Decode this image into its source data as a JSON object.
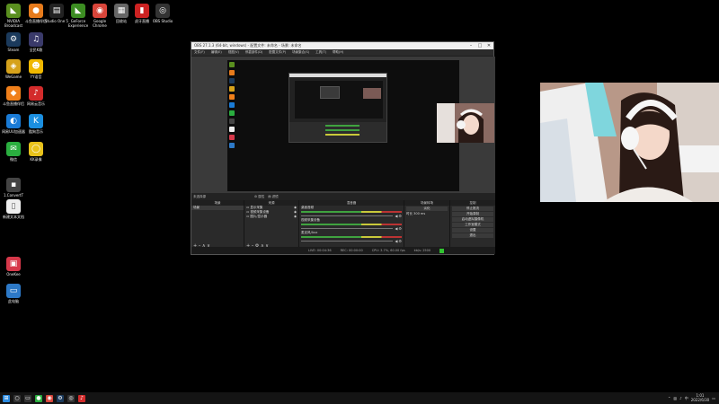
{
  "desktop_icons": [
    {
      "label": "NVIDIA Broadcast",
      "color": "#5a8f1f",
      "glyph": "◣"
    },
    {
      "label": "斗鱼直播伴侣",
      "color": "#e67b1c",
      "glyph": "●"
    },
    {
      "label": "Studio One 5",
      "color": "#222222",
      "glyph": "▤"
    },
    {
      "label": "GeForce Experience",
      "color": "#3c8d22",
      "glyph": "◣"
    },
    {
      "label": "Google Chrome",
      "color": "#d9453a",
      "glyph": "◉"
    },
    {
      "label": "回收站",
      "color": "#666666",
      "glyph": "▦"
    },
    {
      "label": "虎牙直播",
      "color": "#cc2222",
      "glyph": "▮"
    },
    {
      "label": "OBS Studio",
      "color": "#333333",
      "glyph": "◎"
    },
    {
      "label": "Steam",
      "color": "#1b3a5c",
      "glyph": "⚙"
    },
    {
      "label": "全民K歌",
      "color": "#3a3a6a",
      "glyph": "♫"
    },
    {
      "label": "WeGame",
      "color": "#d6a21b",
      "glyph": "◈"
    },
    {
      "label": "YY语音",
      "color": "#f0b800",
      "glyph": "☻"
    },
    {
      "label": "斗鱼直播伴侣",
      "color": "#f07f1a",
      "glyph": "◆"
    },
    {
      "label": "网易云音乐",
      "color": "#d32b2b",
      "glyph": "♪"
    },
    {
      "label": "网易UU加速器",
      "color": "#1a7bd6",
      "glyph": "◐"
    },
    {
      "label": "酷狗音乐",
      "color": "#1b8fe0",
      "glyph": "K"
    },
    {
      "label": "微信",
      "color": "#2aae3f",
      "glyph": "✉"
    },
    {
      "label": "KK录像",
      "color": "#e8c21b",
      "glyph": "◯"
    },
    {
      "label": "1.ConvertT",
      "color": "#444444",
      "glyph": "▪"
    },
    {
      "label": "新建文本文档",
      "color": "#eeeeee",
      "glyph": "▯"
    },
    {
      "label": "OneKee",
      "color": "#d6384a",
      "glyph": "▣"
    },
    {
      "label": "此电脑",
      "color": "#2d79c7",
      "glyph": "▭"
    }
  ],
  "obs": {
    "title": "OBS 27.1.3 (64-bit, windows) - 配置文件: 未命名 - 场景: 未命名",
    "menu": [
      "文件(F)",
      "编辑(E)",
      "视图(V)",
      "停靠部件(D)",
      "配置文件(P)",
      "场景集合(S)",
      "工具(T)",
      "帮助(H)"
    ],
    "toolbar_label": "未选择源",
    "toolbar_props": "属性",
    "toolbar_filters": "滤镜",
    "docks": {
      "scenes": {
        "header": "场景",
        "items": [
          "场景"
        ]
      },
      "sources": {
        "header": "来源",
        "items": [
          "显示采集",
          "视频采集设备",
          "图片/显示器"
        ]
      },
      "mixer": {
        "header": "混音器",
        "channels": [
          "桌面音频",
          "视频采集设备",
          "麦克风/Aux"
        ]
      },
      "transitions": {
        "header": "场景转场",
        "type": "淡化",
        "duration_label": "时长",
        "duration": "300 ms"
      },
      "controls": {
        "header": "控制",
        "buttons": [
          "停止推流",
          "开始录制",
          "启动虚拟摄像机",
          "工作室模式",
          "设置",
          "退出"
        ]
      }
    },
    "status": {
      "live": "LIVE: 00:04:36",
      "rec": "REC: 00:00:00",
      "cpu": "CPU: 3.7%, 60.00 fps",
      "kbps": "kb/s: 2500"
    }
  },
  "taskbar": {
    "apps": [
      {
        "name": "start",
        "color": "#2a8ae0",
        "glyph": "⊞"
      },
      {
        "name": "search",
        "color": "#333333",
        "glyph": "○"
      },
      {
        "name": "task-view",
        "color": "#333333",
        "glyph": "▭"
      },
      {
        "name": "wechat",
        "color": "#2aae3f",
        "glyph": "●"
      },
      {
        "name": "chrome",
        "color": "#d9453a",
        "glyph": "◉"
      },
      {
        "name": "steam",
        "color": "#1b3a5c",
        "glyph": "⚙"
      },
      {
        "name": "obs",
        "color": "#333333",
        "glyph": "◎"
      },
      {
        "name": "netease",
        "color": "#d32b2b",
        "glyph": "♪"
      }
    ],
    "clock_time": "1:01",
    "clock_date": "2022/6/30",
    "lang": "中"
  }
}
